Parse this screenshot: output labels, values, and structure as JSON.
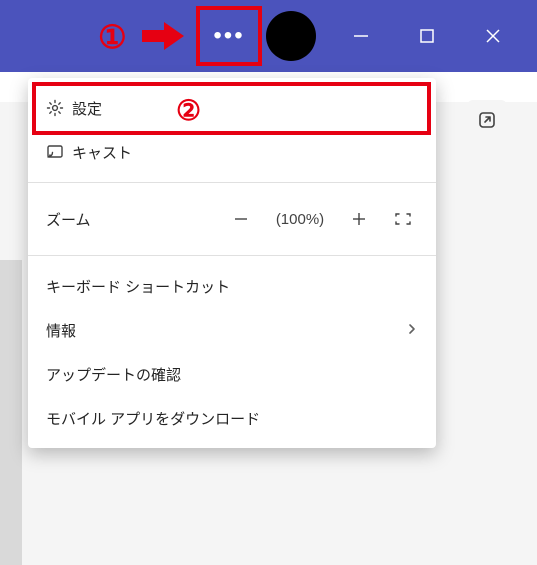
{
  "menu": {
    "settings": "設定",
    "cast": "キャスト",
    "zoom_label": "ズーム",
    "zoom_value": "(100%)",
    "keyboard_shortcuts": "キーボード ショートカット",
    "about": "情報",
    "check_updates": "アップデートの確認",
    "download_mobile": "モバイル アプリをダウンロード"
  },
  "annotations": {
    "step1": "①",
    "step2": "②"
  }
}
